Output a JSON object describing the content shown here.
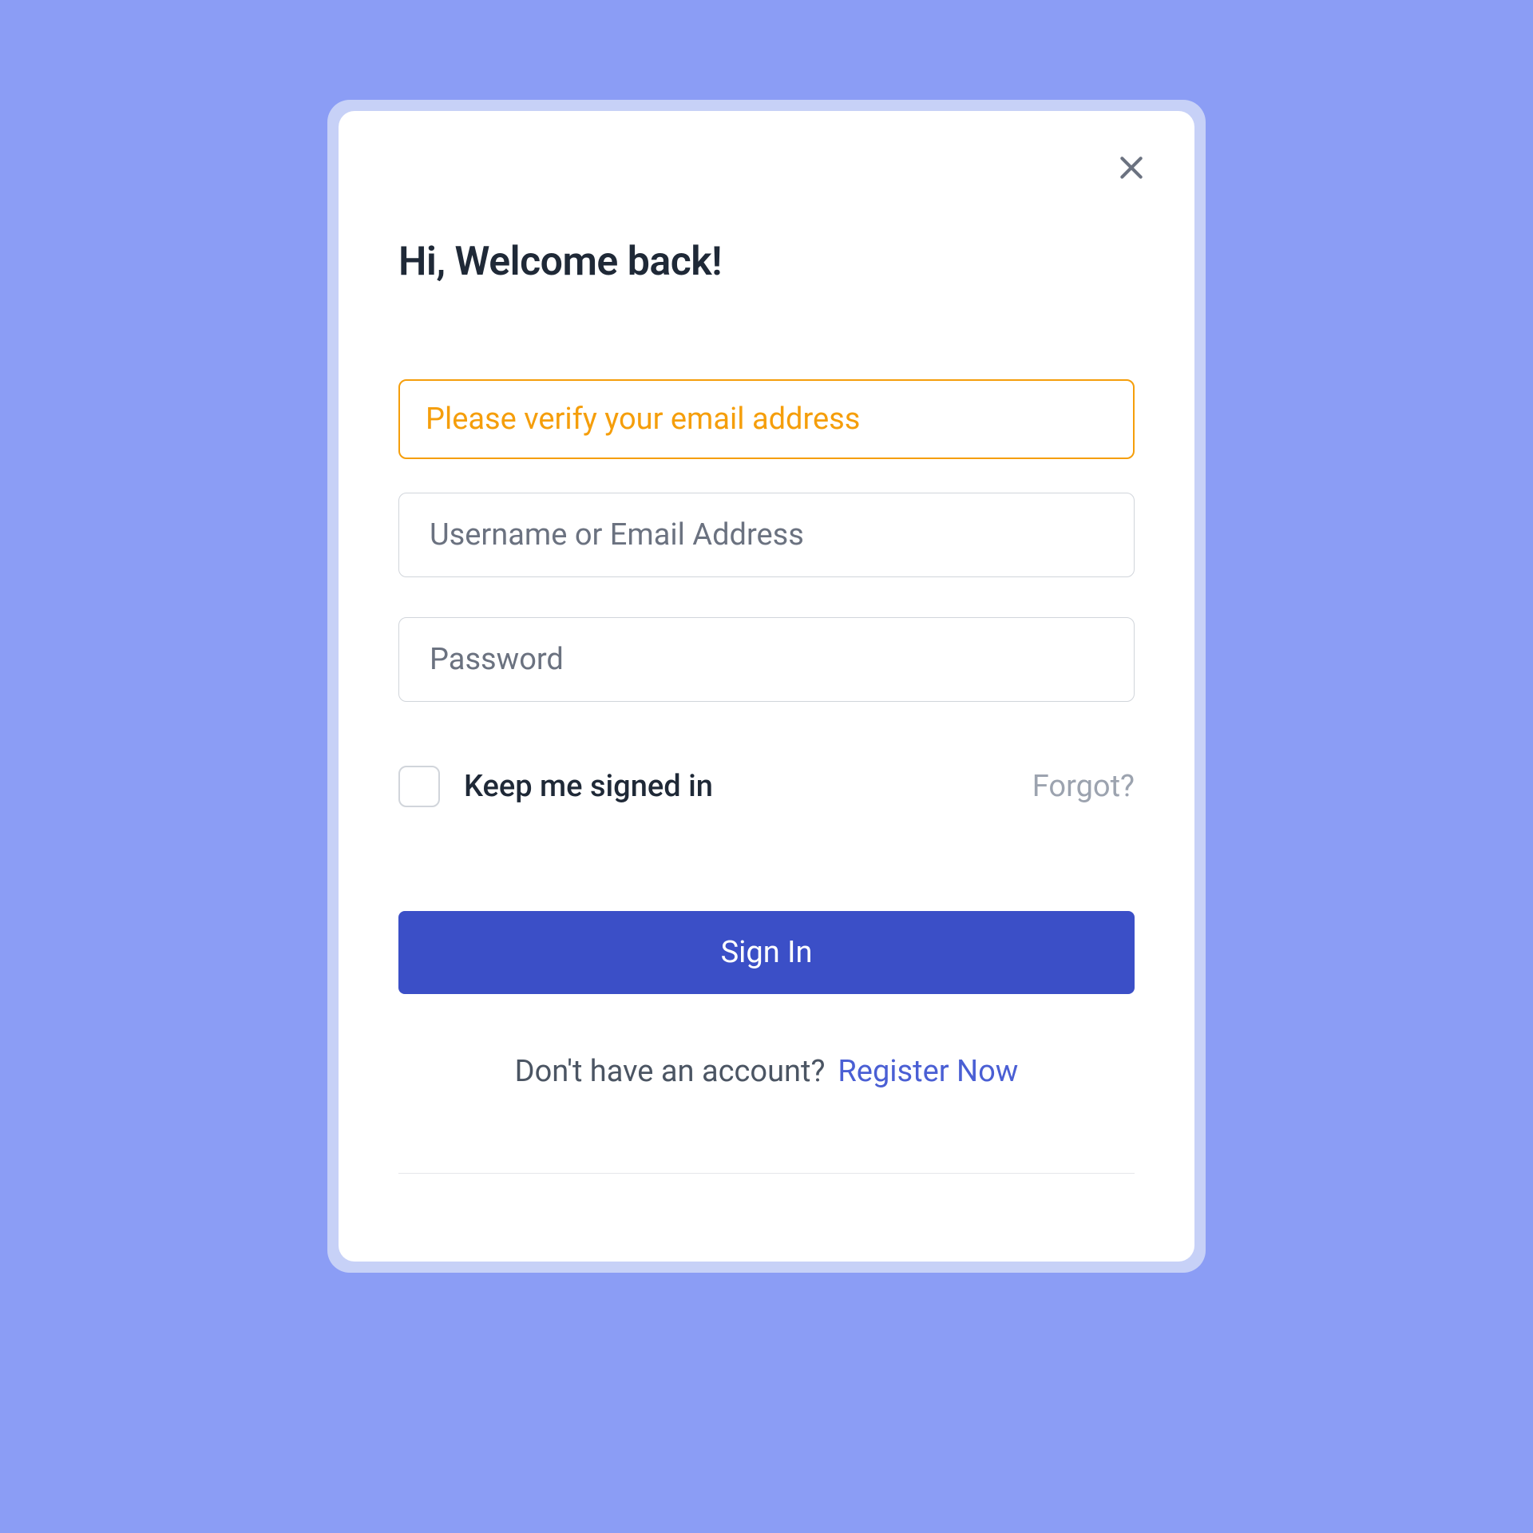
{
  "modal": {
    "title": "Hi, Welcome back!",
    "alert": {
      "message": "Please verify your email address"
    },
    "fields": {
      "username": {
        "placeholder": "Username or Email Address",
        "value": ""
      },
      "password": {
        "placeholder": "Password",
        "value": ""
      }
    },
    "options": {
      "keep_signed_in_label": "Keep me signed in",
      "forgot_label": "Forgot?"
    },
    "signin_label": "Sign In",
    "register": {
      "prompt": "Don't have an account?",
      "link_label": "Register Now"
    }
  }
}
